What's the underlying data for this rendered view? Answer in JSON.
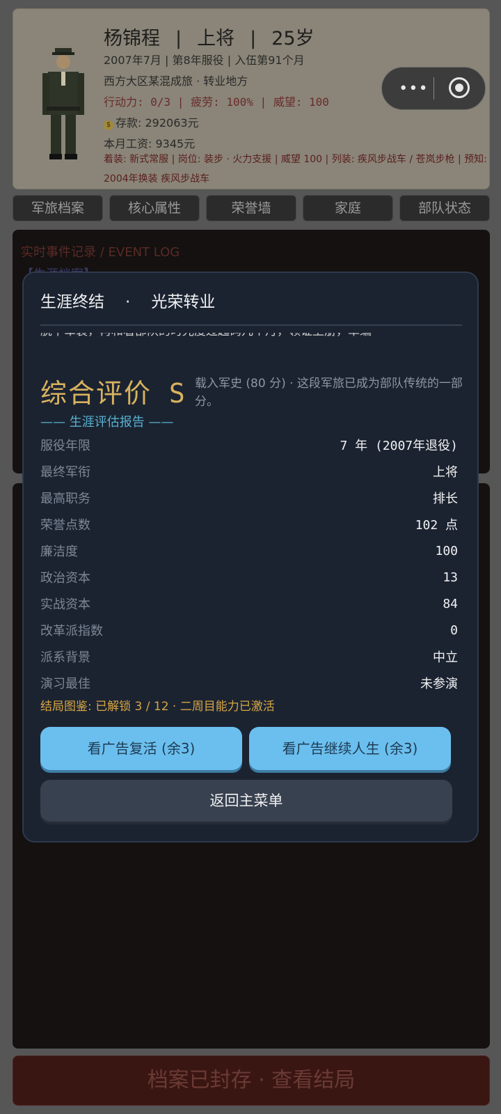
{
  "profile": {
    "name": "杨锦程",
    "rank": "上将",
    "age": "25岁",
    "service_line": "2007年7月 | 第8年服役 | 入伍第91个月",
    "unit_line": "西方大区某混成旅 · 转业地方",
    "status_line": "行动力: 0/3 | 疲劳: 100% | 威望: 100",
    "savings": "存款: 292063元",
    "salary": "本月工资: 9345元",
    "details": "着装: 新式常服 | 岗位: 装步 · 火力支援 | 威望 100 | 列装: 疾风步战车 / 苍岚步枪 | 预知: 2004年换装 疾风步战车"
  },
  "tabs": [
    "军旅档案",
    "核心属性",
    "荣誉墙",
    "家庭",
    "部队状态"
  ],
  "event_log": {
    "title": "实时事件记录 / EVENT LOG",
    "first_row": "【生涯档案】"
  },
  "bottom_bar": "档案已封存 · 查看结局",
  "modal": {
    "title_left": "生涯终结",
    "title_dot": "·",
    "title_right": "光荣转业",
    "scroll_text": "脱下军装，再和着部队的时光度过起码几个月，领证上册，草编",
    "grade": "综合评价 S",
    "grade_desc": "载入军史 (80 分) · 这段军旅已成为部队传统的一部分。",
    "report_title": "—— 生涯评估报告 ——",
    "stats": [
      {
        "key": "服役年限",
        "value": "7 年 (2007年退役)"
      },
      {
        "key": "最终军衔",
        "value": "上将"
      },
      {
        "key": "最高职务",
        "value": "排长"
      },
      {
        "key": "荣誉点数",
        "value": "102 点"
      },
      {
        "key": "廉洁度",
        "value": "100"
      },
      {
        "key": "政治资本",
        "value": "13"
      },
      {
        "key": "实战资本",
        "value": "84"
      },
      {
        "key": "改革派指数",
        "value": "0"
      },
      {
        "key": "派系背景",
        "value": "中立"
      },
      {
        "key": "演习最佳",
        "value": "未参演"
      }
    ],
    "gallery": "结局图鉴: 已解锁 3 / 12 · 二周目能力已激活",
    "btn_revive": "看广告复活 (余3)",
    "btn_continue": "看广告继续人生 (余3)",
    "btn_menu": "返回主菜单"
  },
  "colors": {
    "modal_bg": "#1b2331",
    "grade": "#d8b25e",
    "report_title": "#58b2cf",
    "ad_button": "#6bbfee"
  }
}
